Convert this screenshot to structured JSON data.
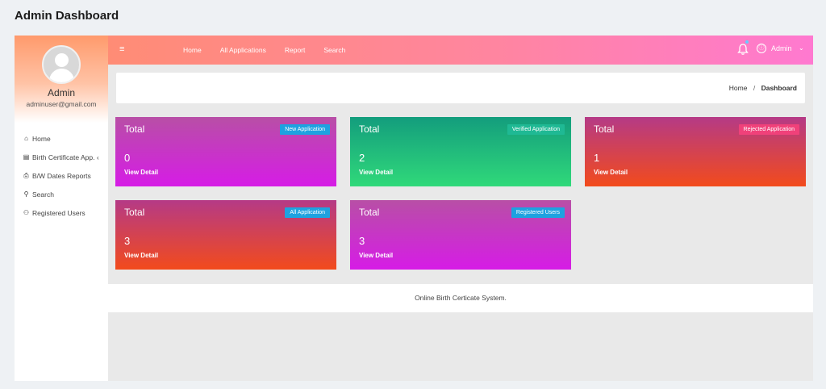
{
  "page": {
    "title": "Admin Dashboard"
  },
  "sidebar": {
    "profile": {
      "name": "Admin",
      "email": "adminuser@gmail.com"
    },
    "items": [
      {
        "icon": "home-icon",
        "glyph": "⌂",
        "label": "Home"
      },
      {
        "icon": "table-icon",
        "glyph": "▤",
        "label": "Birth Certificate App. ‹"
      },
      {
        "icon": "report-icon",
        "glyph": "⎙",
        "label": "B/W Dates Reports"
      },
      {
        "icon": "search-icon",
        "glyph": "⚲",
        "label": "Search"
      },
      {
        "icon": "users-icon",
        "glyph": "⚇",
        "label": "Registered Users"
      }
    ]
  },
  "topbar": {
    "menu_icon": "≡",
    "links": [
      "Home",
      "All Applications",
      "Report",
      "Search"
    ],
    "user": {
      "label": "Admin",
      "caret": "⌄"
    }
  },
  "breadcrumb": {
    "home": "Home",
    "separator": "/",
    "current": "Dashboard"
  },
  "cards": [
    {
      "total_label": "Total",
      "badge": "New Application",
      "count": "0",
      "link": "View Detail",
      "gradient": "purple",
      "badge_color": "#1ea2e0"
    },
    {
      "total_label": "Total",
      "badge": "Verified Application",
      "count": "2",
      "link": "View Detail",
      "gradient": "green",
      "badge_color": "#1fb994"
    },
    {
      "total_label": "Total",
      "badge": "Rejected Application",
      "count": "1",
      "link": "View Detail",
      "gradient": "red",
      "badge_color": "#f0417a"
    },
    {
      "total_label": "Total",
      "badge": "All Application",
      "count": "3",
      "link": "View Detail",
      "gradient": "red",
      "badge_color": "#1ea2e0"
    },
    {
      "total_label": "Total",
      "badge": "Registered Users",
      "count": "3",
      "link": "View Detail",
      "gradient": "purple",
      "badge_color": "#1ea2e0"
    }
  ],
  "footer": {
    "text": "Online Birth Certicate System."
  },
  "colors": {
    "topbar_start": "#ff8c75",
    "topbar_end": "#ff79d0",
    "background": "#eef1f4"
  }
}
